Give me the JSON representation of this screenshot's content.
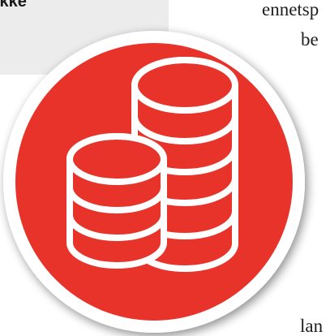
{
  "sidebar_box": {
    "text_fragment": "ikke"
  },
  "article": {
    "line1_fragment": "ennetsp",
    "line2_fragment": "be",
    "line3_fragment": "lan"
  },
  "badge": {
    "icon": "coin-stacks-icon",
    "background_color": "#e8332a",
    "ring_color": "#ffffff",
    "stroke_color": "#ffffff"
  }
}
